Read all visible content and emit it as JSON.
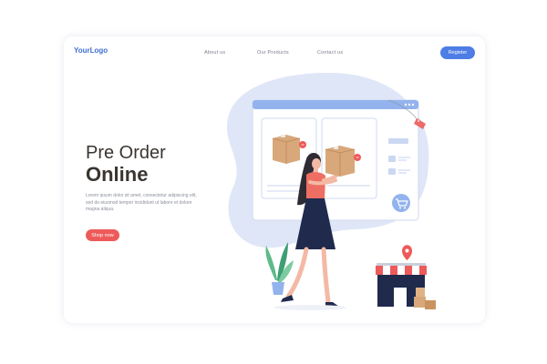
{
  "header": {
    "logo": "YourLogo",
    "nav": [
      "About us",
      "Our Products",
      "Contact us"
    ],
    "register_label": "Register"
  },
  "hero": {
    "title_line1": "Pre Order",
    "title_line2": "Online",
    "description": "Lorem ipsum dolor sit amet, consectetur adipiscing elit, sed do eiusmod tempor incididunt ut labore et dolore magna aliqua.",
    "cta_label": "Shop now"
  },
  "colors": {
    "accent_blue": "#4d7de5",
    "accent_red": "#ee5a5a",
    "blob": "#dfe6f7",
    "text_dark": "#3a3530"
  },
  "icons": [
    "cart-icon",
    "price-tag-icon",
    "location-pin-icon",
    "package-icon",
    "store-icon",
    "plant-icon"
  ]
}
